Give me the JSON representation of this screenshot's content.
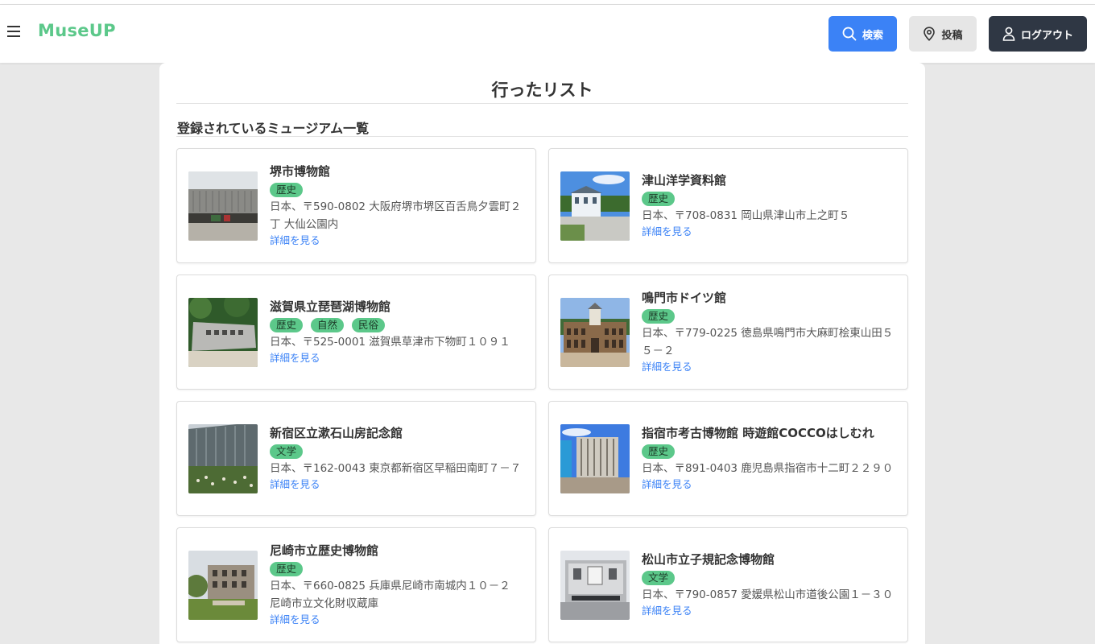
{
  "app": {
    "logo": "MuseUP"
  },
  "header": {
    "search_label": "検索",
    "post_label": "投稿",
    "logout_label": "ログアウト"
  },
  "page": {
    "title": "行ったリスト",
    "section_title": "登録されているミュージアム一覧"
  },
  "colors": {
    "brand": "#5cc88a",
    "primary": "#3b82f6",
    "dark": "#2f3744"
  },
  "museums": [
    {
      "name": "堺市博物館",
      "tags": [
        "歴史"
      ],
      "address": "日本、〒590-0802 大阪府堺市堺区百舌鳥夕雲町２丁 大仙公園内",
      "link": "詳細を見る",
      "image": "concrete-building-photo"
    },
    {
      "name": "津山洋学資料館",
      "tags": [
        "歴史"
      ],
      "address": "日本、〒708-0831 岡山県津山市上之町５",
      "link": "詳細を見る",
      "image": "western-style-building-photo"
    },
    {
      "name": "滋賀県立琵琶湖博物館",
      "tags": [
        "歴史",
        "自然",
        "民俗"
      ],
      "address": "日本、〒525-0001 滋賀県草津市下物町１０９１",
      "link": "詳細を見る",
      "image": "stone-sign-photo"
    },
    {
      "name": "鳴門市ドイツ館",
      "tags": [
        "歴史"
      ],
      "address": "日本、〒779-0225 徳島県鳴門市大麻町桧東山田５５－２",
      "link": "詳細を見る",
      "image": "brick-hall-photo"
    },
    {
      "name": "新宿区立漱石山房記念館",
      "tags": [
        "文学"
      ],
      "address": "日本、〒162-0043 東京都新宿区早稲田南町７－７",
      "link": "詳細を見る",
      "image": "glass-building-garden-photo"
    },
    {
      "name": "指宿市考古博物館 時遊館COCCOはしむれ",
      "tags": [
        "歴史"
      ],
      "address": "日本、〒891-0403 鹿児島県指宿市十二町２２９０",
      "link": "詳細を見る",
      "image": "round-tower-photo"
    },
    {
      "name": "尼崎市立歴史博物館",
      "tags": [
        "歴史"
      ],
      "address": "日本、〒660-0825 兵庫県尼崎市南城内１０－２ 尼崎市立文化財収蔵庫",
      "link": "詳細を見る",
      "image": "old-school-building-photo"
    },
    {
      "name": "松山市立子規記念博物館",
      "tags": [
        "文学"
      ],
      "address": "日本、〒790-0857 愛媛県松山市道後公園１－３０",
      "link": "詳細を見る",
      "image": "white-facade-photo"
    }
  ]
}
